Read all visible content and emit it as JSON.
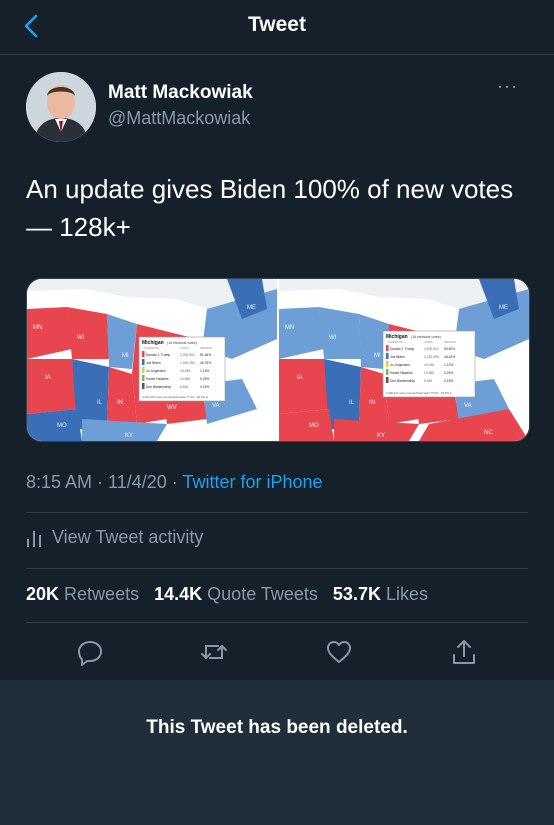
{
  "header": {
    "title": "Tweet"
  },
  "author": {
    "name": "Matt Mackowiak",
    "handle": "@MattMackowiak",
    "more": "···"
  },
  "tweet": {
    "text": "An update gives Biden 100% of new votes — 128k+",
    "time": "8:15 AM · 11/4/20 · ",
    "app": "Twitter for iPhone"
  },
  "activity": {
    "label": "View Tweet activity"
  },
  "stats": {
    "retweets_count": "20K",
    "retweets_label": "Retweets",
    "quotes_count": "14.4K",
    "quotes_label": "Quote Tweets",
    "likes_count": "53.7K",
    "likes_label": "Likes"
  },
  "deleted_notice": "This Tweet has been deleted.",
  "media": {
    "left_map": {
      "states": [
        "MN",
        "WI",
        "MI",
        "IA",
        "IL",
        "IN",
        "OH",
        "MO",
        "KY",
        "WV",
        "VA",
        "ME"
      ],
      "box_title": "Michigan",
      "box_subtitle": "(16 electoral votes)",
      "col_headers": [
        "CANDIDATE",
        "VOTES",
        "PERCENT"
      ],
      "rows": [
        {
          "name": "Donald J. Trump",
          "votes": "2,200,902",
          "pct": "51.64%",
          "color": "#e8464f"
        },
        {
          "name": "Joe Biden",
          "votes": "1,992,356",
          "pct": "46.75%",
          "color": "#3a6fb8"
        },
        {
          "name": "Jo Jorgensen",
          "votes": "49,198",
          "pct": "1.15%",
          "color": "#f2c14e"
        },
        {
          "name": "Howie Hawkins",
          "votes": "10,566",
          "pct": "0.25%",
          "color": "#7fb069"
        },
        {
          "name": "Don Blankenship",
          "votes": "6,549",
          "pct": "0.15%",
          "color": "#555555"
        }
      ],
      "footnote": "4,261,379 votes counted  Estimated 77.3% - 90.5% in"
    },
    "right_map": {
      "states": [
        "MN",
        "WI",
        "MI",
        "IA",
        "IL",
        "IN",
        "OH",
        "MO",
        "KY",
        "VA",
        "ME",
        "NC"
      ],
      "box_title": "Michigan",
      "box_subtitle": "(16 electoral votes)",
      "col_headers": [
        "CANDIDATE",
        "VOTES",
        "PERCENT"
      ],
      "rows": [
        {
          "name": "Donald J. Trump",
          "votes": "2,200,902",
          "pct": "50.52%",
          "color": "#e8464f"
        },
        {
          "name": "Joe Biden",
          "votes": "2,120,495",
          "pct": "48.42%",
          "color": "#3a6fb8"
        },
        {
          "name": "Jo Jorgensen",
          "votes": "49,198",
          "pct": "1.12%",
          "color": "#f2c14e"
        },
        {
          "name": "Howie Hawkins",
          "votes": "10,566",
          "pct": "0.24%",
          "color": "#7fb069"
        },
        {
          "name": "Don Blankenship",
          "votes": "6,549",
          "pct": "0.15%",
          "color": "#555555"
        }
      ],
      "footnote": "4,400,217 votes counted  Estimated 79.6% - 93.8% in"
    }
  },
  "colors": {
    "bg": "#15202b",
    "accent": "#1da1f2",
    "muted": "#8899a6",
    "red": "#e8464f",
    "blue": "#3a6fb8"
  },
  "icons": [
    "back-chevron-icon",
    "more-dots-icon",
    "activity-bars-icon",
    "reply-icon",
    "retweet-icon",
    "like-icon",
    "share-icon"
  ]
}
